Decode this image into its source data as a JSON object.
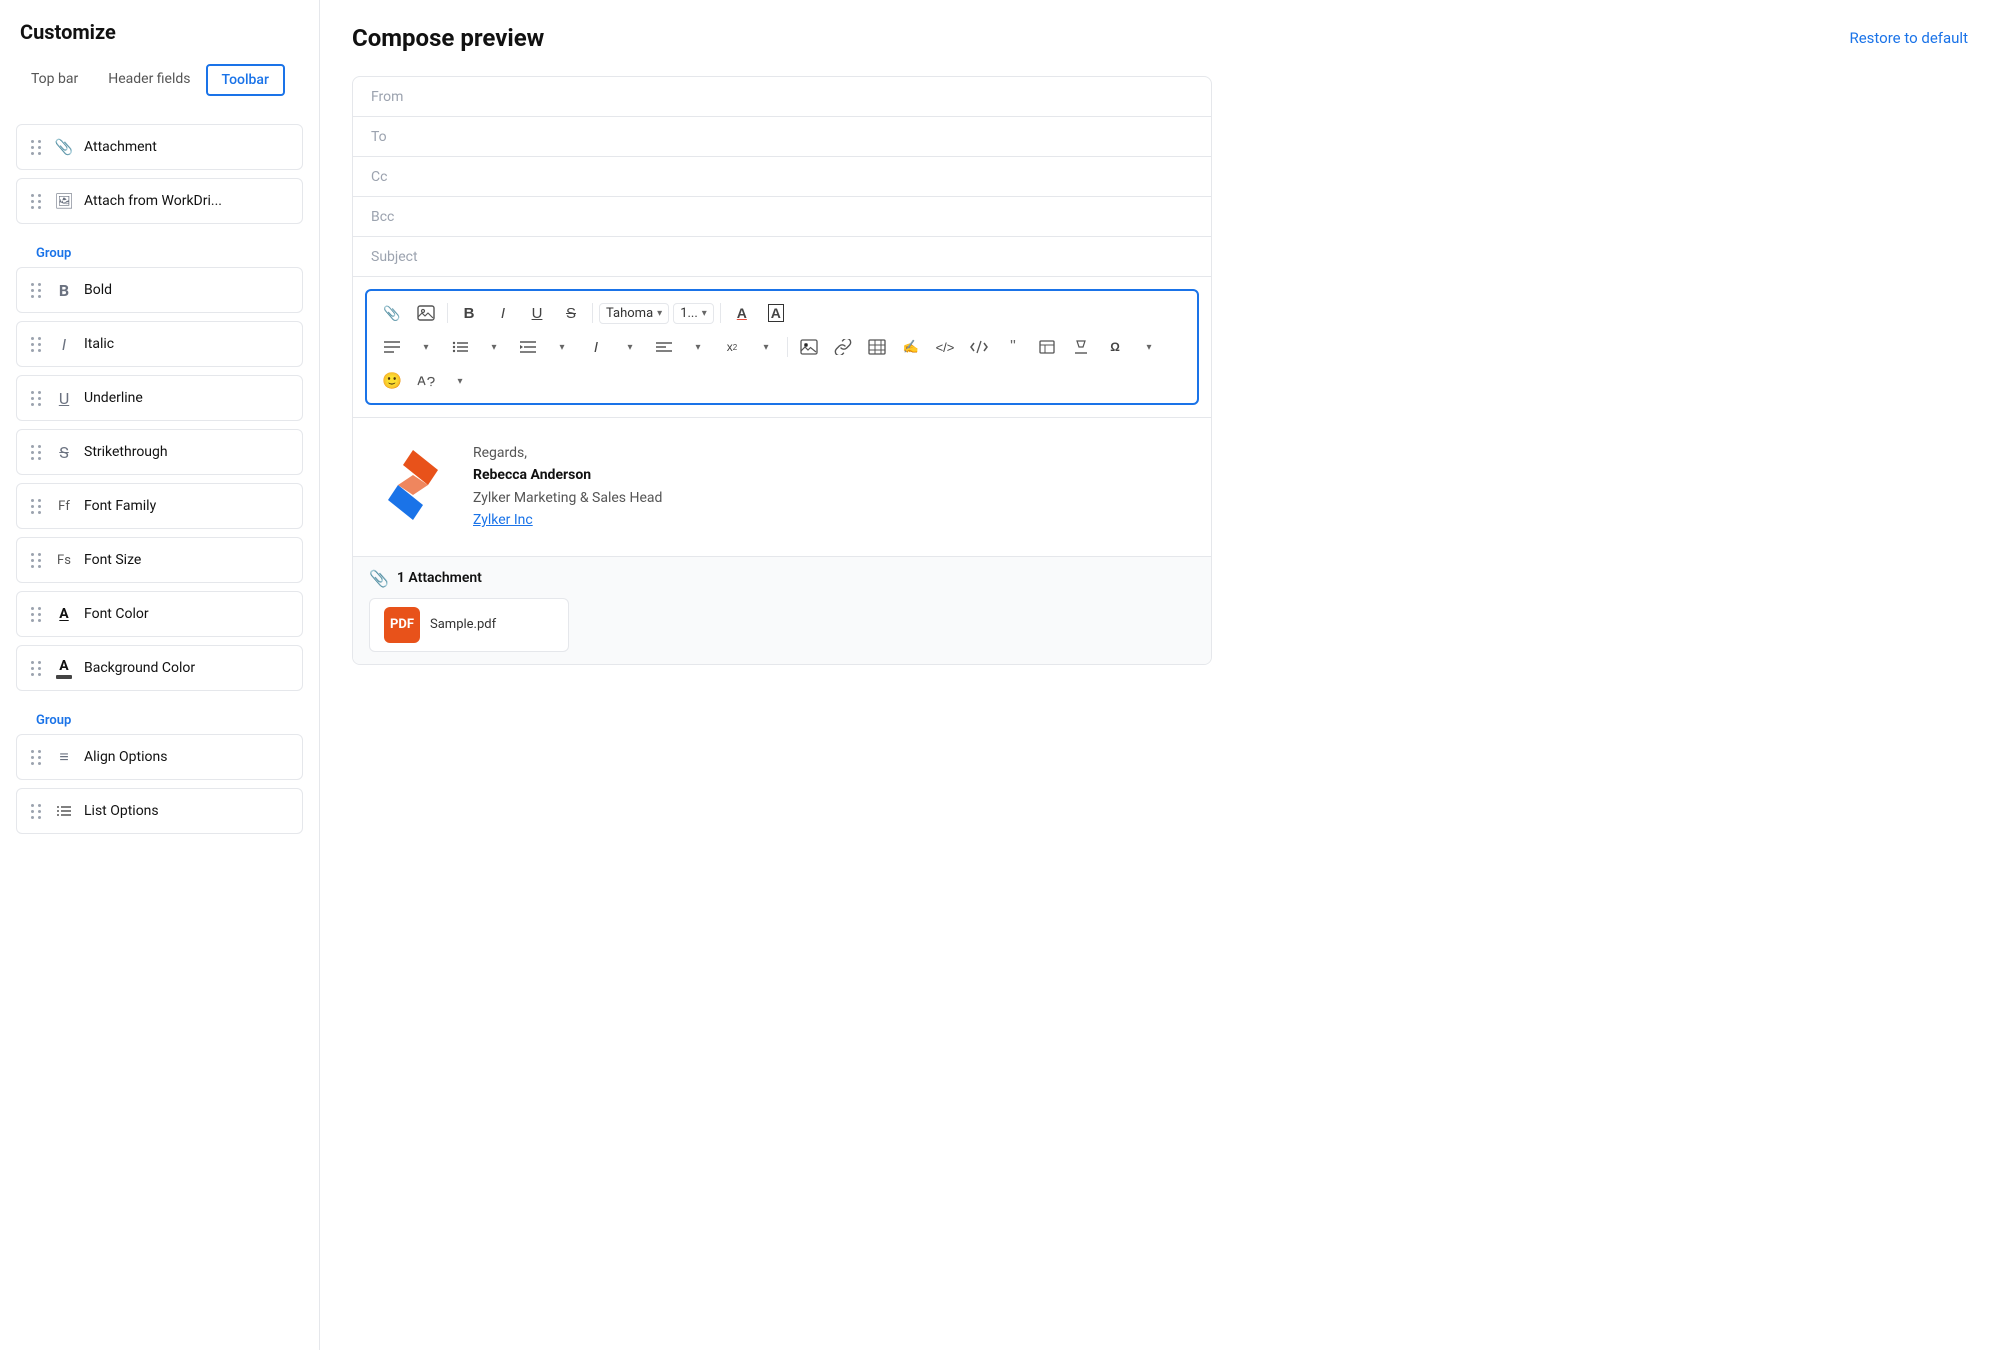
{
  "sidebar": {
    "title": "Customize",
    "tabs": [
      {
        "label": "Top bar",
        "active": false
      },
      {
        "label": "Header fields",
        "active": false
      },
      {
        "label": "Toolbar",
        "active": true
      }
    ],
    "items_top": [
      {
        "id": "attachment",
        "label": "Attachment",
        "icon": "📎"
      },
      {
        "id": "attach-workdrive",
        "label": "Attach from WorkDri...",
        "icon": "🖼"
      }
    ],
    "group1_label": "Group",
    "items_group1": [
      {
        "id": "bold",
        "label": "Bold",
        "icon": "B"
      },
      {
        "id": "italic",
        "label": "Italic",
        "icon": "I"
      },
      {
        "id": "underline",
        "label": "Underline",
        "icon": "U"
      },
      {
        "id": "strikethrough",
        "label": "Strikethrough",
        "icon": "S"
      },
      {
        "id": "font-family",
        "label": "Font Family",
        "icon": "Ff"
      },
      {
        "id": "font-size",
        "label": "Font Size",
        "icon": "Fs"
      },
      {
        "id": "font-color",
        "label": "Font Color",
        "icon": "A"
      },
      {
        "id": "background-color",
        "label": "Background Color",
        "icon": "bg"
      }
    ],
    "group2_label": "Group",
    "items_group2": [
      {
        "id": "align-options",
        "label": "Align Options",
        "icon": "≡"
      },
      {
        "id": "list-options",
        "label": "List Options",
        "icon": "≡"
      }
    ]
  },
  "main": {
    "title": "Compose preview",
    "restore_label": "Restore to default",
    "email_fields": [
      {
        "label": "From"
      },
      {
        "label": "To"
      },
      {
        "label": "Cc"
      },
      {
        "label": "Bcc"
      },
      {
        "label": "Subject"
      }
    ],
    "toolbar": {
      "font_name": "Tahoma",
      "font_size": "1...",
      "row1": [
        "attach",
        "image",
        "bold",
        "italic",
        "underline",
        "strikethrough",
        "font-selector",
        "size-selector",
        "font-color",
        "bg-color"
      ],
      "row2": [
        "align",
        "align-dd",
        "list",
        "list-dd",
        "indent",
        "indent-dd",
        "text-dir",
        "text-dir-dd",
        "line-height",
        "line-height-dd",
        "superscript",
        "superscript-dd",
        "insert-image",
        "link",
        "table",
        "signature",
        "code",
        "code-block",
        "quote",
        "table2",
        "clear",
        "special-char",
        "special-char-dd"
      ],
      "row3": [
        "emoji",
        "spellcheck",
        "spellcheck-dd"
      ]
    },
    "signature": {
      "regards": "Regards,",
      "name": "Rebecca Anderson",
      "title": "Zylker Marketing & Sales Head",
      "company": "Zylker Inc"
    },
    "attachment": {
      "header": "1 Attachment",
      "file_name": "Sample.pdf"
    }
  }
}
